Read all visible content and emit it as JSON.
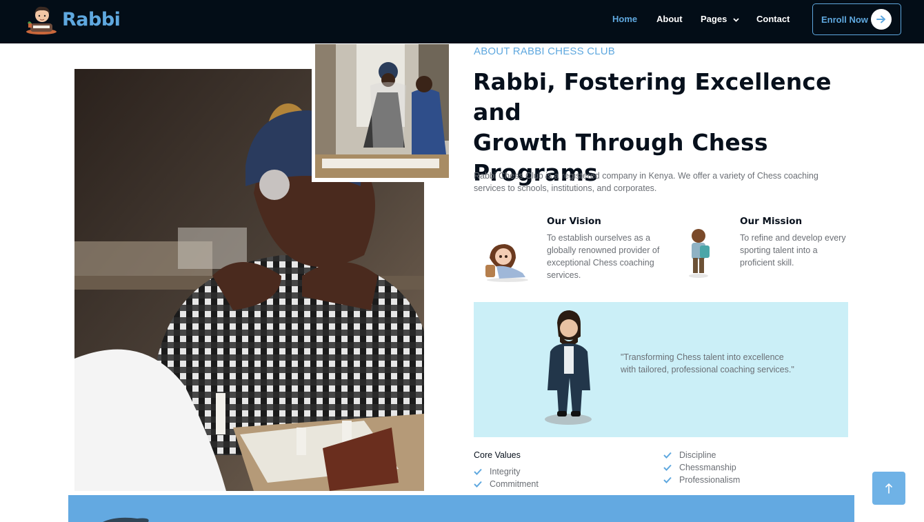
{
  "brand": {
    "name": "Rabbi"
  },
  "nav": {
    "items": [
      {
        "label": "Home"
      },
      {
        "label": "About"
      },
      {
        "label": "Pages"
      },
      {
        "label": "Contact"
      }
    ],
    "cta_label": "Enroll Now"
  },
  "about": {
    "eyebrow": "ABOUT RABBI CHESS CLUB",
    "headline_line1": "Rabbi, Fostering Excellence and",
    "headline_line2": "Growth Through Chess",
    "headline_line3": "Programs",
    "intro": "Rabbi Chess Club is a registered company in Kenya. We offer a variety of Chess coaching services to schools, institutions, and corporates.",
    "vision": {
      "title": "Our Vision",
      "text": "To establish ourselves as a globally renowned provider of exceptional Chess coaching services."
    },
    "mission": {
      "title": "Our Mission",
      "text": "To refine and develop every sporting talent into a proficient skill."
    },
    "quote": "\"Transforming Chess talent into excellence with tailored, professional coaching services.\"",
    "core_values_title": "Core Values",
    "core_values_left": [
      "Integrity",
      "Commitment"
    ],
    "core_values_right": [
      "Discipline",
      "Chessmanship",
      "Professionalism"
    ]
  },
  "colors": {
    "nav_bg": "#030d17",
    "accent": "#5fa8df",
    "quote_bg": "#cbeff7",
    "band": "#63a9e1"
  },
  "icons": [
    "boy-reading-logo-icon",
    "chevron-down-icon",
    "arrow-right-icon",
    "check-icon",
    "arrow-up-icon"
  ]
}
